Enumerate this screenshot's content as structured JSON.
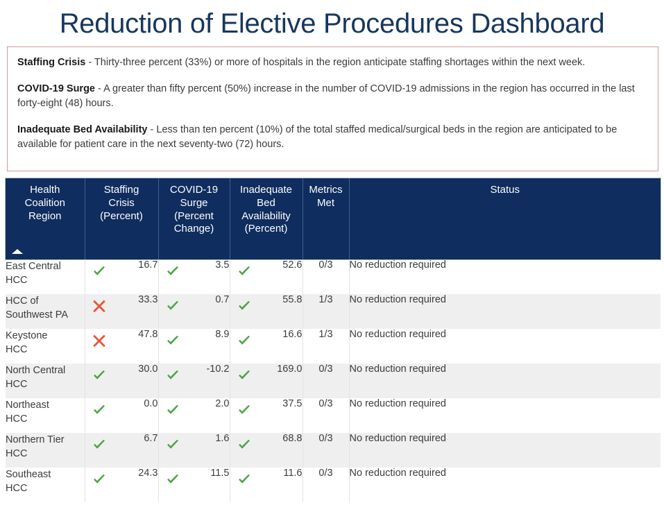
{
  "page": {
    "title": "Reduction of Elective Procedures Dashboard",
    "title_color": "#17375e",
    "header_color": "#0f2d5e",
    "alert_border_color": "#cf9a9a",
    "check_color": "#4aa545",
    "cross_color": "#e8553a"
  },
  "criteria": [
    {
      "name": "Staffing Crisis",
      "separator": " - ",
      "text": "Thirty-three percent (33%) or more of hospitals in the region anticipate staffing shortages within the next week."
    },
    {
      "name": "COVID-19 Surge",
      "separator": " - ",
      "text": "A greater than fifty percent (50%) increase in the number of COVID-19 admissions in the region has occurred in the last forty-eight (48) hours."
    },
    {
      "name": "Inadequate Bed Availability",
      "separator": " - ",
      "text": "Less than ten percent (10%) of the total staffed medical/surgical beds in the region are anticipated to be available for patient care in the next seventy-two (72) hours."
    }
  ],
  "table": {
    "sort_icon": "sort-ascending-triangle",
    "sorted_column": "Health Coalition Region",
    "columns": [
      {
        "key": "region",
        "label": "Health\nCoalition\nRegion"
      },
      {
        "key": "staff",
        "label": "Staffing\nCrisis\n(Percent)"
      },
      {
        "key": "covid",
        "label": "COVID-19\nSurge\n(Percent\nChange)"
      },
      {
        "key": "bed",
        "label": "Inadequate\nBed\nAvailability\n(Percent)"
      },
      {
        "key": "metrics",
        "label": "Metrics\nMet"
      },
      {
        "key": "status",
        "label": "Status"
      }
    ],
    "column_labels": {
      "region_l1": "Health",
      "region_l2": "Coalition",
      "region_l3": "Region",
      "staff_l1": "Staffing",
      "staff_l2": "Crisis",
      "staff_l3": "(Percent)",
      "covid_l1": "COVID-19",
      "covid_l2": "Surge",
      "covid_l3": "(Percent",
      "covid_l4": "Change)",
      "bed_l1": "Inadequate",
      "bed_l2": "Bed",
      "bed_l3": "Availability",
      "bed_l4": "(Percent)",
      "metrics_l1": "Metrics",
      "metrics_l2": "Met",
      "status_l1": "Status"
    },
    "rows": [
      {
        "region_l1": "East Central",
        "region_l2": "HCC",
        "staff_icon": "check-icon",
        "staff_value": "16.7",
        "covid_icon": "check-icon",
        "covid_value": "3.5",
        "bed_icon": "check-icon",
        "bed_value": "52.6",
        "metrics_met": "0/3",
        "status": "No reduction required"
      },
      {
        "region_l1": "HCC of",
        "region_l2": "Southwest PA",
        "staff_icon": "cross-icon",
        "staff_value": "33.3",
        "covid_icon": "check-icon",
        "covid_value": "0.7",
        "bed_icon": "check-icon",
        "bed_value": "55.8",
        "metrics_met": "1/3",
        "status": "No reduction required"
      },
      {
        "region_l1": "Keystone",
        "region_l2": "HCC",
        "staff_icon": "cross-icon",
        "staff_value": "47.8",
        "covid_icon": "check-icon",
        "covid_value": "8.9",
        "bed_icon": "check-icon",
        "bed_value": "16.6",
        "metrics_met": "1/3",
        "status": "No reduction required"
      },
      {
        "region_l1": "North Central",
        "region_l2": "HCC",
        "staff_icon": "check-icon",
        "staff_value": "30.0",
        "covid_icon": "check-icon",
        "covid_value": "-10.2",
        "bed_icon": "check-icon",
        "bed_value": "169.0",
        "metrics_met": "0/3",
        "status": "No reduction required"
      },
      {
        "region_l1": "Northeast",
        "region_l2": "HCC",
        "staff_icon": "check-icon",
        "staff_value": "0.0",
        "covid_icon": "check-icon",
        "covid_value": "2.0",
        "bed_icon": "check-icon",
        "bed_value": "37.5",
        "metrics_met": "0/3",
        "status": "No reduction required"
      },
      {
        "region_l1": "Northern Tier",
        "region_l2": "HCC",
        "staff_icon": "check-icon",
        "staff_value": "6.7",
        "covid_icon": "check-icon",
        "covid_value": "1.6",
        "bed_icon": "check-icon",
        "bed_value": "68.8",
        "metrics_met": "0/3",
        "status": "No reduction required"
      },
      {
        "region_l1": "Southeast",
        "region_l2": "HCC",
        "staff_icon": "check-icon",
        "staff_value": "24.3",
        "covid_icon": "check-icon",
        "covid_value": "11.5",
        "bed_icon": "check-icon",
        "bed_value": "11.6",
        "metrics_met": "0/3",
        "status": "No reduction required"
      }
    ]
  }
}
